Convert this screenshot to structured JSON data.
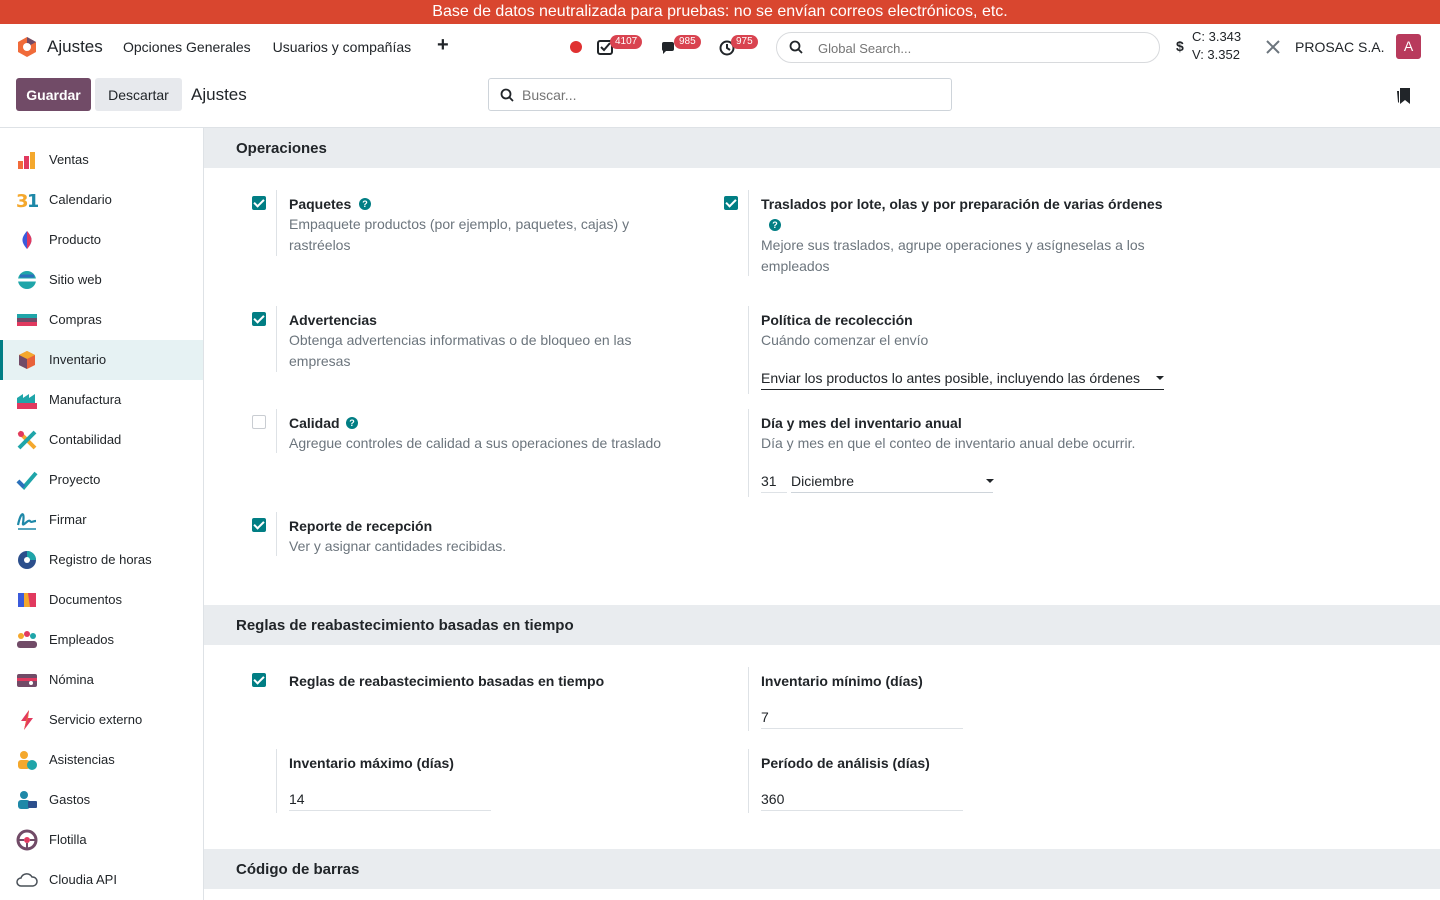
{
  "banner": "Base de datos neutralizada para pruebas: no se envían correos electrónicos, etc.",
  "header": {
    "app_name": "Ajustes",
    "menu": [
      "Opciones Generales",
      "Usuarios y compañías"
    ],
    "badges": {
      "activities": "4107",
      "messages": "985",
      "timers": "975"
    },
    "global_search_placeholder": "Global Search...",
    "currency_symbol": "$",
    "c_value": "C: 3.343",
    "v_value": "V: 3.352",
    "company": "PROSAC S.A.",
    "avatar_letter": "A"
  },
  "control": {
    "save_label": "Guardar",
    "discard_label": "Descartar",
    "title": "Ajustes",
    "search_placeholder": "Buscar..."
  },
  "sidebar": {
    "items": [
      {
        "label": "Ventas",
        "icon": "sales-icon"
      },
      {
        "label": "Calendario",
        "icon": "calendar-icon"
      },
      {
        "label": "Producto",
        "icon": "product-icon"
      },
      {
        "label": "Sitio web",
        "icon": "website-icon"
      },
      {
        "label": "Compras",
        "icon": "purchase-icon"
      },
      {
        "label": "Inventario",
        "icon": "inventory-icon",
        "active": true
      },
      {
        "label": "Manufactura",
        "icon": "manufacturing-icon"
      },
      {
        "label": "Contabilidad",
        "icon": "accounting-icon"
      },
      {
        "label": "Proyecto",
        "icon": "project-icon"
      },
      {
        "label": "Firmar",
        "icon": "sign-icon"
      },
      {
        "label": "Registro de horas",
        "icon": "timesheet-icon"
      },
      {
        "label": "Documentos",
        "icon": "documents-icon"
      },
      {
        "label": "Empleados",
        "icon": "employees-icon"
      },
      {
        "label": "Nómina",
        "icon": "payroll-icon"
      },
      {
        "label": "Servicio externo",
        "icon": "field-service-icon"
      },
      {
        "label": "Asistencias",
        "icon": "attendance-icon"
      },
      {
        "label": "Gastos",
        "icon": "expenses-icon"
      },
      {
        "label": "Flotilla",
        "icon": "fleet-icon"
      },
      {
        "label": "Cloudia API",
        "icon": "cloud-icon"
      }
    ]
  },
  "sections": {
    "operaciones": "Operaciones",
    "reglas": "Reglas de reabastecimiento basadas en tiempo",
    "barcode": "Código de barras"
  },
  "settings": {
    "paquetes": {
      "title": "Paquetes",
      "desc": "Empaquete productos (por ejemplo, paquetes, cajas) y rastréelos",
      "checked": true
    },
    "traslados": {
      "title": "Traslados por lote, olas y por preparación de varias órdenes",
      "desc": "Mejore sus traslados, agrupe operaciones y asígneselas a los empleados",
      "checked": true
    },
    "advertencias": {
      "title": "Advertencias",
      "desc": "Obtenga advertencias informativas o de bloqueo en las empresas",
      "checked": true
    },
    "politica": {
      "title": "Política de recolección",
      "desc": "Cuándo comenzar el envío",
      "value": "Enviar los productos lo antes posible, incluyendo las órdenes"
    },
    "calidad": {
      "title": "Calidad",
      "desc": "Agregue controles de calidad a sus operaciones de traslado",
      "checked": false
    },
    "dia_mes": {
      "title": "Día y mes del inventario anual",
      "desc": "Día y mes en que el conteo de inventario anual debe ocurrir.",
      "day": "31",
      "month": "Diciembre"
    },
    "reporte": {
      "title": "Reporte de recepción",
      "desc": "Ver y asignar cantidades recibidas.",
      "checked": true
    },
    "reglas_tiempo": {
      "title": "Reglas de reabastecimiento basadas en tiempo",
      "checked": true
    },
    "inv_min": {
      "title": "Inventario mínimo (días)",
      "value": "7"
    },
    "inv_max": {
      "title": "Inventario máximo (días)",
      "value": "14"
    },
    "periodo": {
      "title": "Período de análisis (días)",
      "value": "360"
    }
  },
  "colors": {
    "brand": "#714b67",
    "accent": "#017e84",
    "banner": "#d9462f",
    "badge": "#d94350"
  }
}
